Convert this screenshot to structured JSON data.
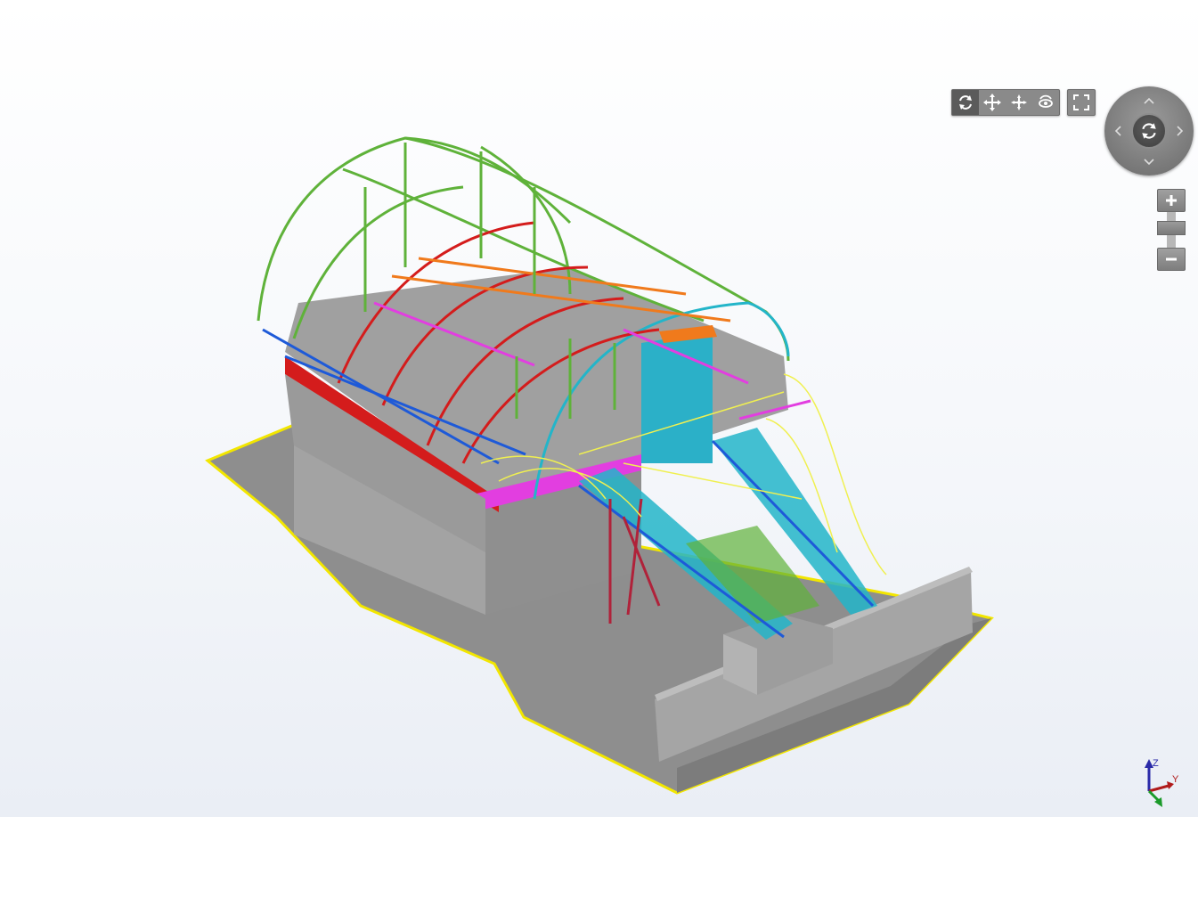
{
  "toolbar": {
    "tools": [
      {
        "name": "orbit",
        "icon": "orbit-icon",
        "active": true
      },
      {
        "name": "pan",
        "icon": "pan-icon",
        "active": false
      },
      {
        "name": "move",
        "icon": "move-icon",
        "active": false
      },
      {
        "name": "look-around",
        "icon": "look-around-icon",
        "active": false
      }
    ],
    "fullscreen_icon": "fullscreen-icon"
  },
  "nav_wheel": {
    "center_icon": "orbit-icon",
    "arrows": [
      "up",
      "down",
      "left",
      "right"
    ]
  },
  "zoom": {
    "plus_icon": "plus-icon",
    "minus_icon": "minus-icon",
    "level": 0.5
  },
  "axis_triad": {
    "z_label": "Z",
    "y_label": "Y"
  },
  "colors": {
    "ground": "#8c8c8c",
    "ground_outline": "#f2e600",
    "concrete": "#9a9a9a",
    "steel_green": "#5fb23a",
    "steel_red": "#d01c1c",
    "steel_cyan": "#23b5c9",
    "steel_blue": "#1e5ad8",
    "steel_magenta": "#e23ee0",
    "steel_orange": "#f07a1c",
    "steel_yellow": "#f0f050",
    "controls": "#858585"
  }
}
